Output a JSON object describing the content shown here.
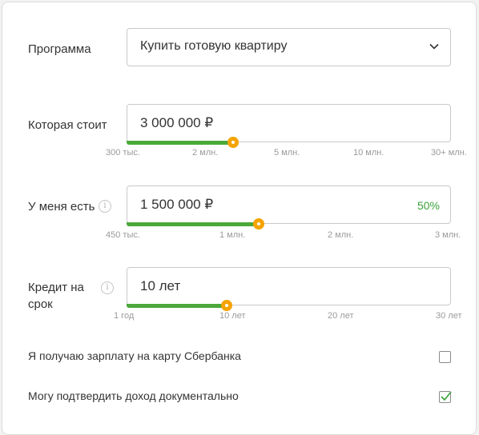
{
  "program": {
    "label": "Программа",
    "value": "Купить готовую квартиру"
  },
  "price": {
    "label": "Которая стоит",
    "value": "3 000 000 ₽",
    "slider_fraction": 0.33,
    "ticks": [
      "300 тыс.",
      "2 млн.",
      "5 млн.",
      "10 млн.",
      "30+ млн."
    ]
  },
  "down_payment": {
    "label": "У меня есть",
    "value": "1 500 000 ₽",
    "percent": "50%",
    "slider_fraction": 0.41,
    "ticks": [
      "450 тыс.",
      "1 млн.",
      "2 млн.",
      "3 млн."
    ]
  },
  "term": {
    "label": "Кредит на срок",
    "label_line1": "Кредит на",
    "label_line2": "срок",
    "value": "10 лет",
    "slider_fraction": 0.31,
    "ticks": [
      "1 год",
      "10 лет",
      "20 лет",
      "30 лет"
    ]
  },
  "options": {
    "salary_card": {
      "label": "Я получаю зарплату на карту Сбербанка",
      "checked": false
    },
    "income_proof": {
      "label": "Могу подтвердить доход документально",
      "checked": true
    }
  },
  "icons": {
    "info": "i",
    "chevron": "chevron-down-icon",
    "check": "checkmark-icon"
  },
  "colors": {
    "accent_green": "#4ba83a",
    "knob_orange": "#f5a300",
    "percent_green": "#3aa33a"
  }
}
